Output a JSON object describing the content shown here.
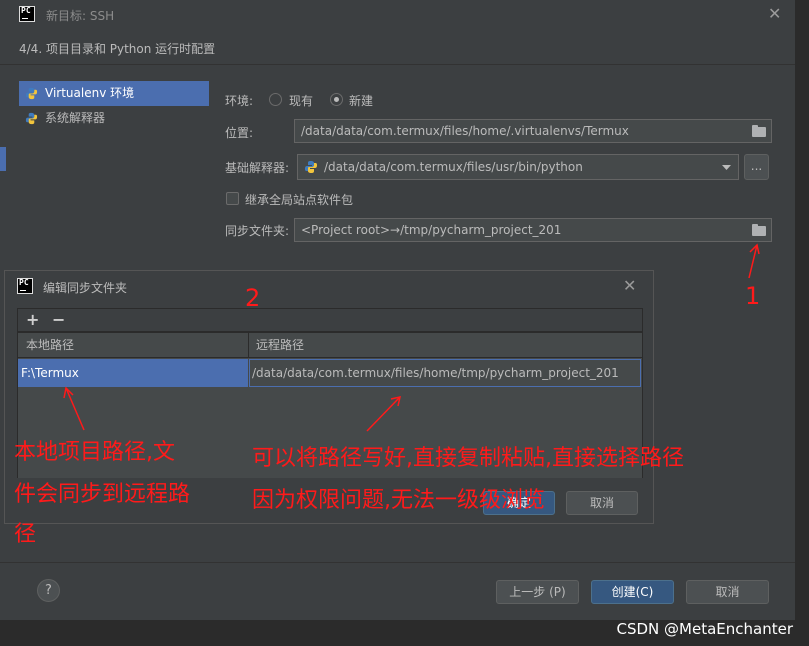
{
  "window": {
    "logo": "PC",
    "title": "新目标: SSH"
  },
  "step_title": "4/4. 项目目录和 Python 运行时配置",
  "env_list": [
    {
      "label": "Virtualenv 环境",
      "selected": true
    },
    {
      "label": "系统解释器",
      "selected": false
    }
  ],
  "form": {
    "env_label": "环境:",
    "env_options": [
      "现有",
      "新建"
    ],
    "env_selected": "新建",
    "location_label": "位置:",
    "location_value": "/data/data/com.termux/files/home/.virtualenvs/Termux",
    "base_label": "基础解释器:",
    "base_value": "/data/data/com.termux/files/usr/bin/python",
    "base_more": "...",
    "inherit_label": "继承全局站点软件包",
    "sync_label": "同步文件夹:",
    "sync_value": "<Project root>→/tmp/pycharm_project_201"
  },
  "inner_dialog": {
    "logo": "PC",
    "title": "编辑同步文件夹",
    "toolbar": {
      "add": "+",
      "remove": "−"
    },
    "columns": [
      "本地路径",
      "远程路径"
    ],
    "rows": [
      {
        "local": "F:\\Termux",
        "remote": "/data/data/com.termux/files/home/tmp/pycharm_project_201"
      }
    ],
    "ok_label": "确定",
    "cancel_label": "取消"
  },
  "footer": {
    "help": "?",
    "prev_label": "上一步 (P)",
    "create_label": "创建(C)",
    "cancel_label": "取消"
  },
  "annotations": {
    "num1": "1",
    "num2": "2",
    "left_note_line1": "本地项目路径,文",
    "left_note_line2": "件会同步到远程路",
    "left_note_line3": "径",
    "right_note_line1": "可以将路径写好,直接复制粘贴,直接选择路径",
    "right_note_line2": "因为权限问题,无法一级级浏览"
  },
  "watermark": "CSDN @MetaEnchanter",
  "colors": {
    "selection": "#4b6eaf",
    "annotation": "#ff1a1a",
    "primary_button": "#365880"
  }
}
